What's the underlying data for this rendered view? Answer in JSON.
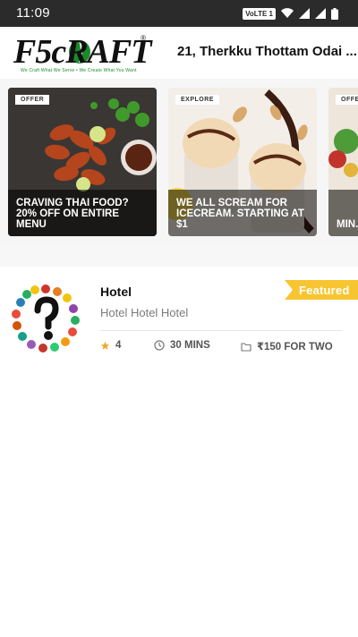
{
  "status_bar": {
    "time": "11:09",
    "network_badge": "VoLTE 1"
  },
  "header": {
    "logo": {
      "text": "F5cRAFT",
      "tagline": "We Craft What We Serve • We Create What You Want"
    },
    "location": "21, Therkku Thottam Odai ..."
  },
  "offers": [
    {
      "badge": "OFFER",
      "title": "CRAVING THAI FOOD? 20% OFF ON ENTIRE MENU"
    },
    {
      "badge": "EXPLORE",
      "title": "WE ALL SCREAM FOR ICECREAM. STARTING AT $1"
    },
    {
      "badge": "OFFER",
      "title": "MIN... ON T... OPT..."
    }
  ],
  "restaurant": {
    "name": "Hotel",
    "description": "Hotel Hotel Hotel",
    "featured_label": "Featured",
    "rating": "4",
    "delivery_time": "30 MINS",
    "cost_for_two": "₹150 FOR TWO"
  },
  "colors": {
    "accent": "#f5a623",
    "featured_bg": "#f7c531",
    "status_bar": "#2b2b2b",
    "logo_green": "#1a8a2a"
  }
}
